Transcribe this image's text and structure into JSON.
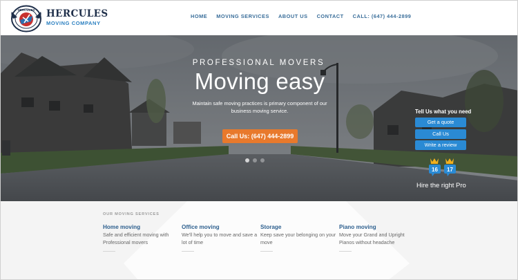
{
  "brand": {
    "name": "HERCULES",
    "subtitle": "MOVING COMPANY",
    "logo_ring_text": "HERCULES"
  },
  "nav": [
    {
      "label": "HOME"
    },
    {
      "label": "MOVING SERVICES"
    },
    {
      "label": "ABOUT US"
    },
    {
      "label": "CONTACT"
    },
    {
      "label": "CALL: (647) 444-2899"
    }
  ],
  "hero": {
    "kicker": "PROFESSIONAL MOVERS",
    "headline": "Moving easy",
    "description": "Maintain safe moving practices is primary component of our business moving service.",
    "cta_label": "Call Us: (647) 444-2899",
    "slide_count": 3,
    "active_slide": 1
  },
  "sidebar": {
    "title": "Tell Us what you need",
    "buttons": [
      {
        "label": "Get a quote"
      },
      {
        "label": "Call Us"
      },
      {
        "label": "Write a review"
      }
    ],
    "badges": [
      "16",
      "17"
    ],
    "tagline": "Hire the right Pro"
  },
  "services": {
    "section_label": "OUR MOVING SERVICES",
    "items": [
      {
        "title": "Home moving",
        "text": "Safe and efficient moving with Professional movers"
      },
      {
        "title": "Office moving",
        "text": "We'll help you to move and save a lot of time"
      },
      {
        "title": "Storage",
        "text": "Keep save your belonging on your move"
      },
      {
        "title": "Piano moving",
        "text": "Move your Grand and Upright Pianos without headache"
      }
    ]
  },
  "colors": {
    "accent": "#e8792c",
    "link": "#3a6e9a",
    "button": "#2a8ad4",
    "service_title": "#2d5f8e"
  }
}
